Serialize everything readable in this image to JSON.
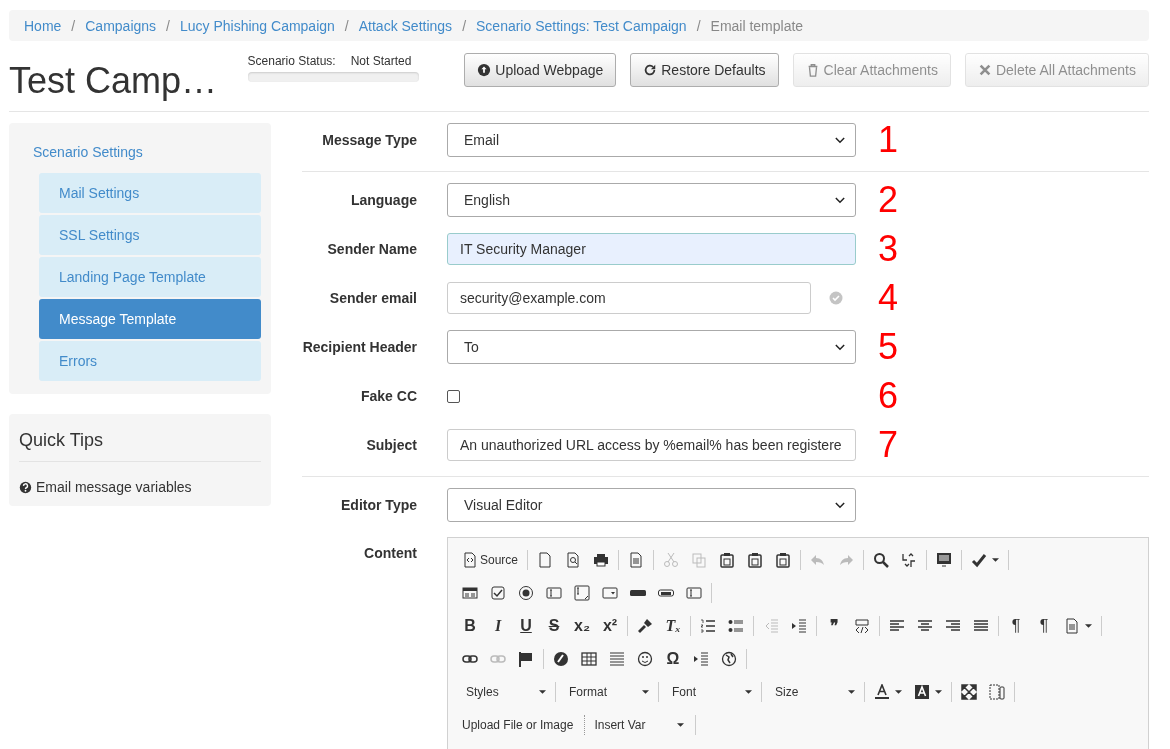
{
  "breadcrumb": [
    {
      "label": "Home",
      "current": false
    },
    {
      "separator": "/",
      "label": "Campaigns",
      "current": false
    },
    {
      "separator": "/",
      "label": "Lucy Phishing Campaign",
      "current": false
    },
    {
      "separator": "/",
      "label": "Attack Settings",
      "current": false
    },
    {
      "separator": "/",
      "label": "Scenario Settings: Test Campaign",
      "current": false
    },
    {
      "separator": "/",
      "label": "Email template",
      "current": true
    }
  ],
  "page_title": "Test Camp…",
  "scenario_status": {
    "label": "Scenario Status:",
    "value": "Not Started",
    "level": 0
  },
  "actions": [
    {
      "label": "Upload Webpage",
      "kind": "upload",
      "disabled": false
    },
    {
      "label": "Restore Defaults",
      "kind": "refresh",
      "disabled": false
    },
    {
      "label": "Clear Attachments",
      "kind": "trash",
      "disabled": true
    },
    {
      "label": "Delete All Attachments",
      "kind": "x",
      "disabled": true
    }
  ],
  "sidebar": {
    "heading": "Scenario Settings",
    "items": [
      {
        "label": "Mail Settings",
        "selected": false
      },
      {
        "label": "SSL Settings",
        "selected": false
      },
      {
        "label": "Landing Page Template",
        "selected": false
      },
      {
        "label": "Message Template",
        "selected": true
      },
      {
        "label": "Errors",
        "selected": false
      }
    ]
  },
  "quick_tips": {
    "title": "Quick Tips",
    "link": "Email message variables"
  },
  "field_groups": [
    [
      {
        "label": "Message Type",
        "kind": "select",
        "value": "Email",
        "marker": "1"
      }
    ],
    [
      {
        "label": "Language",
        "kind": "select",
        "value": "English",
        "marker": "2"
      },
      {
        "label": "Sender Name",
        "kind": "input",
        "value": "IT Security Manager",
        "marker": "3",
        "highlighted": true
      },
      {
        "label": "Sender email",
        "kind": "email",
        "value": "security@example.com",
        "marker": "4",
        "highlighted": false
      },
      {
        "label": "Recipient Header",
        "kind": "select",
        "value": "To",
        "marker": "5"
      },
      {
        "label": "Fake CC",
        "kind": "checkbox",
        "checked": false,
        "marker": "6"
      },
      {
        "label": "Subject",
        "kind": "input",
        "value": "An unauthorized URL access by %email% has been registere",
        "marker": "7",
        "highlighted": false
      }
    ],
    [
      {
        "label": "Editor Type",
        "kind": "select",
        "value": "Visual Editor"
      }
    ]
  ],
  "content": {
    "label": "Content",
    "toolbar_rows": [
      [
        [
          {
            "kind": "source",
            "text": "Source",
            "disabled": false
          }
        ],
        [
          {
            "kind": "page",
            "disabled": false
          },
          {
            "kind": "preview",
            "disabled": false
          },
          {
            "kind": "print",
            "disabled": false
          }
        ],
        [
          {
            "kind": "lines-doc",
            "disabled": false
          }
        ],
        [
          {
            "kind": "cut",
            "disabled": true
          },
          {
            "kind": "copy",
            "disabled": true
          },
          {
            "kind": "clipboard",
            "disabled": false
          },
          {
            "kind": "clipboard",
            "disabled": false
          },
          {
            "kind": "clipboard",
            "disabled": false
          }
        ],
        [
          {
            "kind": "undo",
            "disabled": true
          },
          {
            "kind": "redo",
            "disabled": true
          }
        ],
        [
          {
            "kind": "search",
            "disabled": false
          },
          {
            "kind": "swap",
            "disabled": false
          }
        ],
        [
          {
            "kind": "lines-box",
            "disabled": false
          }
        ],
        [
          {
            "kind": "check",
            "disabled": false,
            "dropdown": true
          }
        ]
      ],
      [
        [
          {
            "kind": "form",
            "disabled": false
          },
          {
            "kind": "checkbox",
            "disabled": false
          },
          {
            "kind": "radio",
            "disabled": false
          },
          {
            "kind": "textfield",
            "disabled": false
          },
          {
            "kind": "textarea",
            "disabled": false
          },
          {
            "kind": "select",
            "disabled": false
          },
          {
            "kind": "pill",
            "disabled": false
          },
          {
            "kind": "pill-outline",
            "disabled": false
          },
          {
            "kind": "textfield",
            "disabled": false
          }
        ]
      ],
      [
        [
          {
            "kind": "bold",
            "glyph": "B",
            "disabled": false
          },
          {
            "kind": "italic",
            "glyph": "I",
            "disabled": false
          },
          {
            "kind": "underline",
            "glyph": "U",
            "disabled": false
          },
          {
            "kind": "strike",
            "glyph": "S",
            "disabled": false
          },
          {
            "kind": "bold",
            "glyph": "x₂",
            "disabled": false
          },
          {
            "kind": "bold",
            "glyph": "x²",
            "disabled": false
          }
        ],
        [
          {
            "kind": "brush",
            "disabled": false
          },
          {
            "kind": "italic",
            "glyph": "Tₓ",
            "disabled": false
          }
        ],
        [
          {
            "kind": "ol",
            "disabled": false
          },
          {
            "kind": "ul",
            "disabled": false
          }
        ],
        [
          {
            "kind": "outdent",
            "disabled": true
          },
          {
            "kind": "indent",
            "disabled": false
          }
        ],
        [
          {
            "kind": "bold",
            "glyph": "❞",
            "disabled": false
          },
          {
            "kind": "div",
            "disabled": false
          }
        ],
        [
          {
            "kind": "align-left",
            "disabled": false
          },
          {
            "kind": "align-center",
            "disabled": false
          },
          {
            "kind": "align-right",
            "disabled": false
          },
          {
            "kind": "justify",
            "disabled": false
          }
        ],
        [
          {
            "kind": "plain",
            "glyph": "¶",
            "disabled": false
          },
          {
            "kind": "plain",
            "glyph": "¶",
            "disabled": false
          },
          {
            "kind": "lines-doc",
            "disabled": false,
            "dropdown": true
          }
        ]
      ],
      [
        [
          {
            "kind": "link",
            "disabled": false
          },
          {
            "kind": "link",
            "disabled": true
          },
          {
            "kind": "flag",
            "disabled": false
          }
        ],
        [
          {
            "kind": "circle",
            "disabled": false
          },
          {
            "kind": "table",
            "disabled": false
          },
          {
            "kind": "hlines",
            "disabled": false
          },
          {
            "kind": "smiley",
            "disabled": false
          },
          {
            "kind": "bold",
            "glyph": "Ω",
            "disabled": false
          },
          {
            "kind": "indent",
            "disabled": false
          },
          {
            "kind": "globe",
            "disabled": false
          }
        ]
      ]
    ],
    "combos": [
      {
        "label": "Styles"
      },
      {
        "label": "Format"
      },
      {
        "label": "Font"
      },
      {
        "label": "Size"
      }
    ],
    "extra_buttons": [
      "Upload File or Image",
      "Insert Var"
    ]
  }
}
